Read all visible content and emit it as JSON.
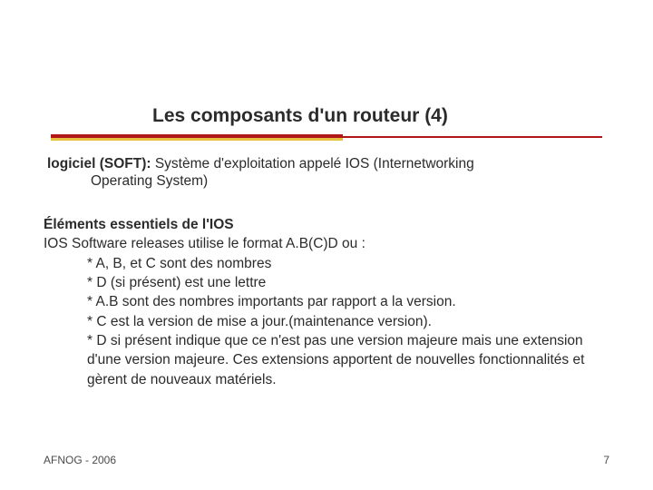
{
  "title": "Les composants d'un routeur (4)",
  "para1": {
    "lead": "logiciel (SOFT):",
    "tail": " Système d'exploitation appelé IOS (Internetworking",
    "cont": "Operating System)"
  },
  "para2": {
    "heading": "Éléments essentiels de l'IOS",
    "line": "IOS Software releases utilise le format A.B(C)D ou :",
    "bullets": [
      "* A, B, et C sont des nombres",
      "* D (si présent) est une lettre",
      "* A.B sont des nombres importants par rapport a la version.",
      "* C est la version de mise a jour.(maintenance version).",
      "* D si présent indique que ce n'est pas une version majeure mais une extension d'une version majeure. Ces extensions apportent de nouvelles fonctionnalités et gèrent de nouveaux matériels."
    ]
  },
  "footer": {
    "left": "AFNOG - 2006",
    "right": "7"
  }
}
